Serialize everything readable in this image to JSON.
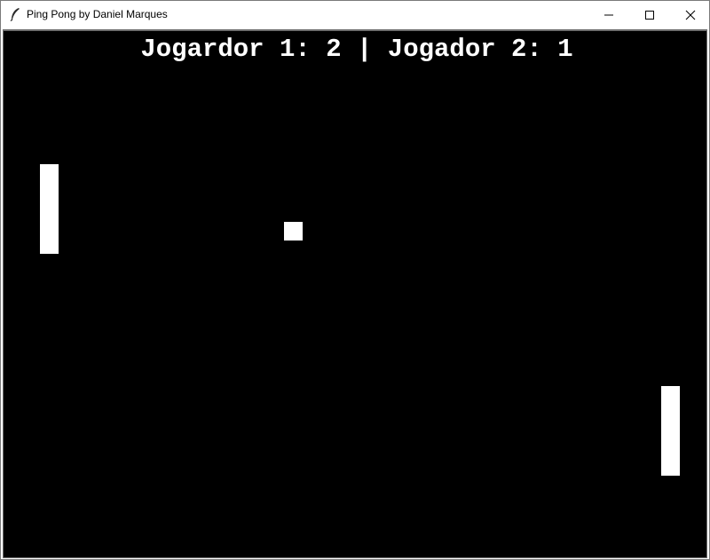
{
  "window": {
    "title": "Ping Pong by Daniel Marques",
    "icon": "feather-icon",
    "controls": [
      "minimize-icon",
      "maximize-icon",
      "close-icon"
    ]
  },
  "game": {
    "score_text": "Jogardor 1: 2 | Jogador 2: 1",
    "player1_score": 2,
    "player2_score": 1,
    "background_color": "#000000",
    "foreground_color": "#ffffff"
  }
}
